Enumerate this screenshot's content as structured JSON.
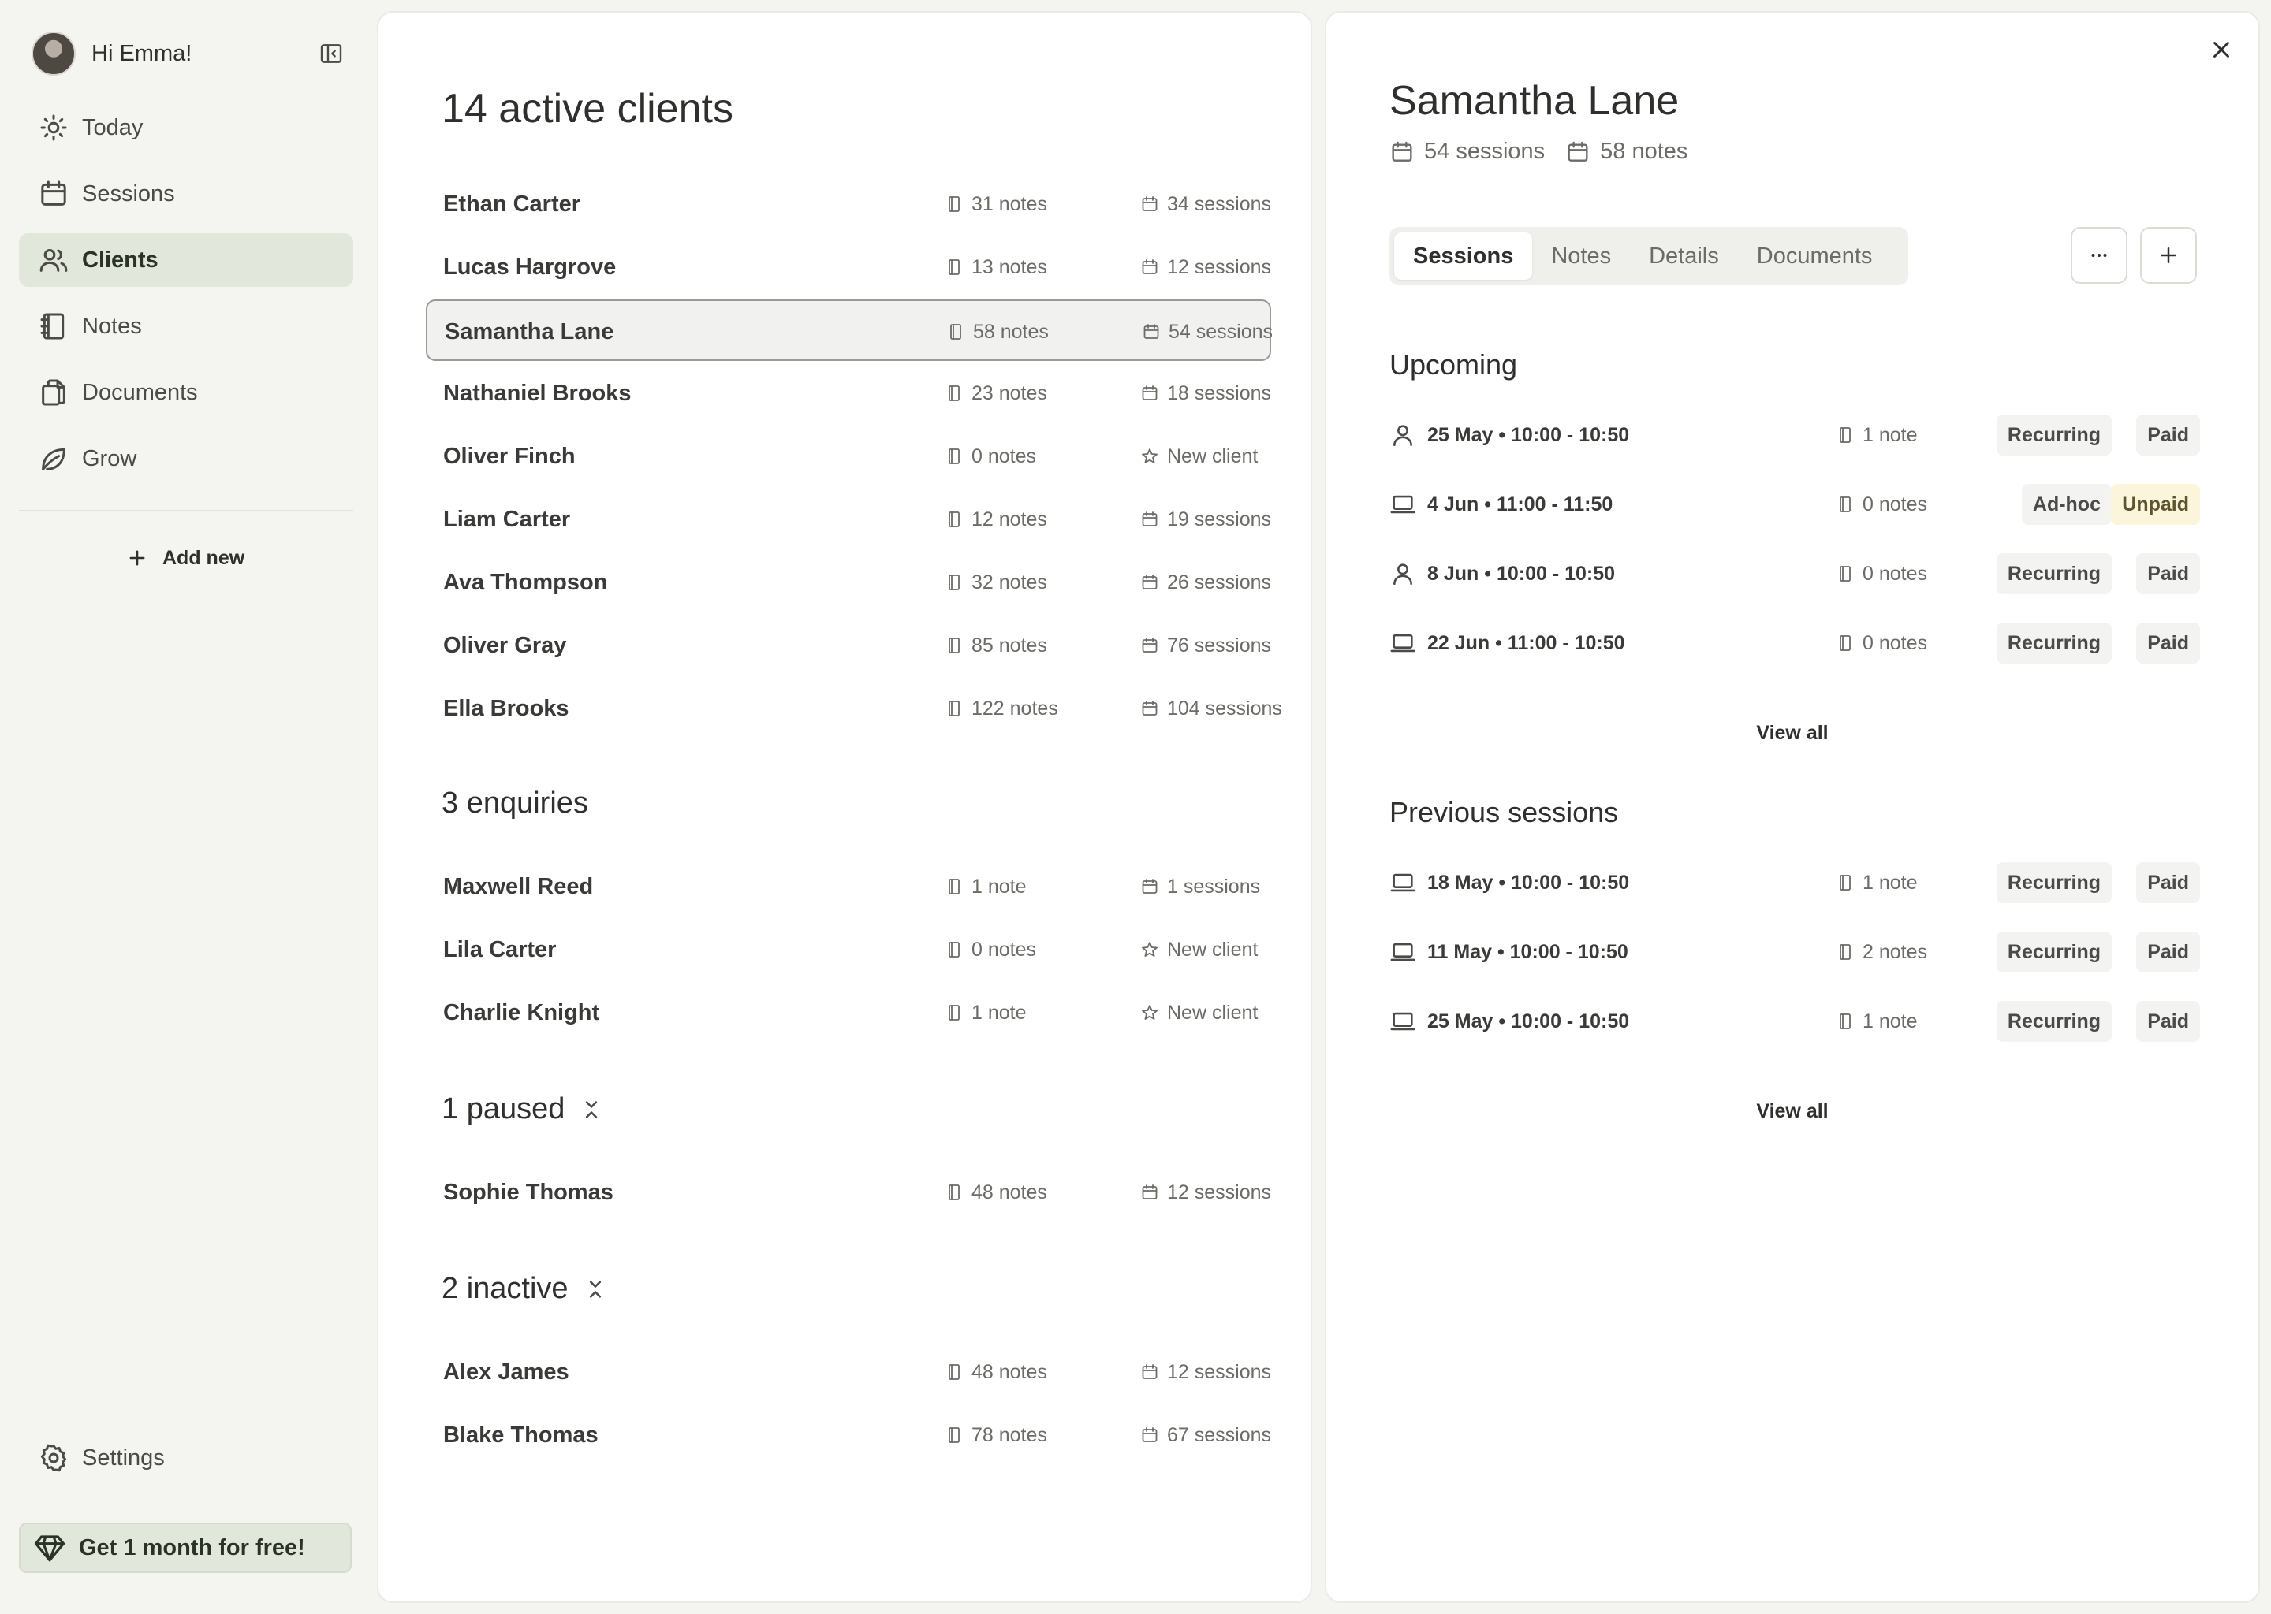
{
  "sidebar": {
    "greeting": "Hi Emma!",
    "nav": [
      {
        "label": "Today",
        "icon": "sun-icon"
      },
      {
        "label": "Sessions",
        "icon": "calendar-icon"
      },
      {
        "label": "Clients",
        "icon": "users-icon",
        "active": true
      },
      {
        "label": "Notes",
        "icon": "notebook-icon"
      },
      {
        "label": "Documents",
        "icon": "documents-icon"
      },
      {
        "label": "Grow",
        "icon": "leaf-icon"
      }
    ],
    "add_new": "Add new",
    "settings": "Settings",
    "promo": "Get 1 month for free!"
  },
  "clients": {
    "active_title": "14 active clients",
    "active": [
      {
        "name": "Ethan Carter",
        "notes": "31 notes",
        "sessions": "34 sessions"
      },
      {
        "name": "Lucas Hargrove",
        "notes": "13 notes",
        "sessions": "12 sessions"
      },
      {
        "name": "Samantha Lane",
        "notes": "58 notes",
        "sessions": "54 sessions",
        "selected": true
      },
      {
        "name": "Nathaniel Brooks",
        "notes": "23 notes",
        "sessions": "18 sessions"
      },
      {
        "name": "Oliver Finch",
        "notes": "0 notes",
        "sessions": "New client"
      },
      {
        "name": "Liam Carter",
        "notes": "12 notes",
        "sessions": "19 sessions"
      },
      {
        "name": "Ava Thompson",
        "notes": "32 notes",
        "sessions": "26 sessions"
      },
      {
        "name": "Oliver Gray",
        "notes": "85 notes",
        "sessions": "76 sessions"
      },
      {
        "name": "Ella Brooks",
        "notes": "122 notes",
        "sessions": "104 sessions"
      }
    ],
    "enquiries_title": "3 enquiries",
    "enquiries": [
      {
        "name": "Maxwell Reed",
        "notes": "1 note",
        "sessions": "1 sessions"
      },
      {
        "name": "Lila Carter",
        "notes": "0 notes",
        "sessions": "New client"
      },
      {
        "name": "Charlie Knight",
        "notes": "1 note",
        "sessions": "New client"
      }
    ],
    "paused_title": "1 paused",
    "paused": [
      {
        "name": "Sophie Thomas",
        "notes": "48 notes",
        "sessions": "12 sessions"
      }
    ],
    "inactive_title": "2 inactive",
    "inactive": [
      {
        "name": "Alex James",
        "notes": "48 notes",
        "sessions": "12 sessions"
      },
      {
        "name": "Blake Thomas",
        "notes": "78 notes",
        "sessions": "67 sessions"
      }
    ]
  },
  "detail": {
    "name": "Samantha Lane",
    "sessions_count": "54 sessions",
    "notes_count": "58 notes",
    "tabs": [
      "Sessions",
      "Notes",
      "Details",
      "Documents"
    ],
    "active_tab": "Sessions",
    "upcoming_title": "Upcoming",
    "upcoming": [
      {
        "mode": "in-person",
        "when": "25 May • 10:00 - 10:50",
        "notes": "1 note",
        "type": "Recurring",
        "payment": "Paid"
      },
      {
        "mode": "online",
        "when": "4 Jun • 11:00 - 11:50",
        "notes": "0 notes",
        "type": "Ad-hoc",
        "payment": "Unpaid"
      },
      {
        "mode": "in-person",
        "when": "8 Jun • 10:00 - 10:50",
        "notes": "0 notes",
        "type": "Recurring",
        "payment": "Paid"
      },
      {
        "mode": "online",
        "when": "22 Jun • 11:00 - 10:50",
        "notes": "0 notes",
        "type": "Recurring",
        "payment": "Paid"
      }
    ],
    "previous_title": "Previous sessions",
    "previous": [
      {
        "mode": "online",
        "when": "18 May • 10:00 - 10:50",
        "notes": "1 note",
        "type": "Recurring",
        "payment": "Paid"
      },
      {
        "mode": "online",
        "when": "11 May • 10:00 - 10:50",
        "notes": "2 notes",
        "type": "Recurring",
        "payment": "Paid"
      },
      {
        "mode": "online",
        "when": "25 May • 10:00 - 10:50",
        "notes": "1 note",
        "type": "Recurring",
        "payment": "Paid"
      }
    ],
    "view_all": "View all"
  },
  "colors": {
    "accent_bg": "#e2e7dc",
    "unpaid_bg": "#fbf5dc",
    "page_bg": "#f4f4f1"
  }
}
